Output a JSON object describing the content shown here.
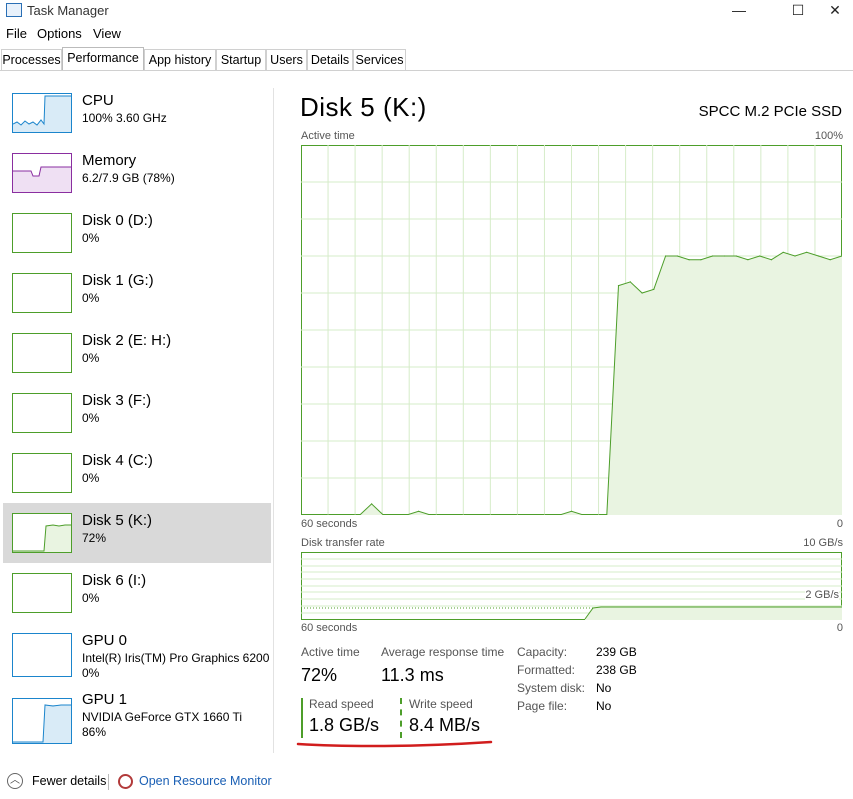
{
  "window": {
    "title": "Task Manager",
    "minimize": "—",
    "maximize": "☐",
    "close": "✕",
    "icon": "task-manager-icon"
  },
  "menu": [
    "File",
    "Options",
    "View"
  ],
  "tabs": [
    "Processes",
    "Performance",
    "App history",
    "Startup",
    "Users",
    "Details",
    "Services"
  ],
  "active_tab": "Performance",
  "sidebar": [
    {
      "name": "CPU",
      "sub1": "100% 3.60 GHz",
      "sub2": "",
      "color": "#1b85cc"
    },
    {
      "name": "Memory",
      "sub1": "6.2/7.9 GB (78%)",
      "sub2": "",
      "color": "#8a2ea0"
    },
    {
      "name": "Disk 0 (D:)",
      "sub1": "0%",
      "sub2": "",
      "color": "#4d9e2a"
    },
    {
      "name": "Disk 1 (G:)",
      "sub1": "0%",
      "sub2": "",
      "color": "#4d9e2a"
    },
    {
      "name": "Disk 2 (E: H:)",
      "sub1": "0%",
      "sub2": "",
      "color": "#4d9e2a"
    },
    {
      "name": "Disk 3 (F:)",
      "sub1": "0%",
      "sub2": "",
      "color": "#4d9e2a"
    },
    {
      "name": "Disk 4 (C:)",
      "sub1": "0%",
      "sub2": "",
      "color": "#4d9e2a"
    },
    {
      "name": "Disk 5 (K:)",
      "sub1": "72%",
      "sub2": "",
      "color": "#4d9e2a"
    },
    {
      "name": "Disk 6 (I:)",
      "sub1": "0%",
      "sub2": "",
      "color": "#4d9e2a"
    },
    {
      "name": "GPU 0",
      "sub1": "Intel(R) Iris(TM) Pro Graphics 6200",
      "sub2": "0%",
      "color": "#1b85cc"
    },
    {
      "name": "GPU 1",
      "sub1": "NVIDIA GeForce GTX 1660 Ti",
      "sub2": "86%",
      "color": "#1b85cc"
    }
  ],
  "selected_index": 7,
  "detail": {
    "title": "Disk 5 (K:)",
    "model": "SPCC M.2 PCIe SSD",
    "graph1": {
      "label": "Active time",
      "max": "100%",
      "xleft": "60 seconds",
      "xright": "0"
    },
    "graph2": {
      "label": "Disk transfer rate",
      "max": "10 GB/s",
      "mid": "2 GB/s",
      "xleft": "60 seconds",
      "xright": "0"
    },
    "stats": {
      "active_time_label": "Active time",
      "active_time": "72%",
      "avg_response_label": "Average response time",
      "avg_response": "11.3 ms",
      "read_label": "Read speed",
      "read": "1.8 GB/s",
      "write_label": "Write speed",
      "write": "8.4 MB/s"
    },
    "info": [
      {
        "label": "Capacity:",
        "value": "239 GB"
      },
      {
        "label": "Formatted:",
        "value": "238 GB"
      },
      {
        "label": "System disk:",
        "value": "No"
      },
      {
        "label": "Page file:",
        "value": "No"
      }
    ]
  },
  "footer": {
    "fewer": "Fewer details",
    "monitor": "Open Resource Monitor"
  },
  "chart_data": {
    "type": "area",
    "title": "Active time",
    "y_unit": "%",
    "ylim": [
      0,
      100
    ],
    "x_label_left": "60 seconds",
    "x_label_right": "0",
    "values": [
      0,
      0,
      0,
      0,
      0,
      0,
      3,
      0,
      0,
      0,
      1,
      0,
      0,
      0,
      0,
      0,
      0,
      0,
      0,
      0,
      0,
      0,
      0,
      1,
      0,
      0,
      0,
      62,
      63,
      60,
      61,
      70,
      70,
      69,
      69,
      70,
      70,
      70,
      69,
      70,
      69,
      71,
      70,
      71,
      70,
      69,
      70
    ]
  },
  "colors": {
    "disk": "#4d9e2a",
    "disk_fill": "#e9f4e1",
    "grid": "#d6ecc9",
    "cpu": "#1b85cc",
    "memory": "#8a2ea0",
    "underline": "#d11d1d",
    "link": "#1a5fb4"
  }
}
